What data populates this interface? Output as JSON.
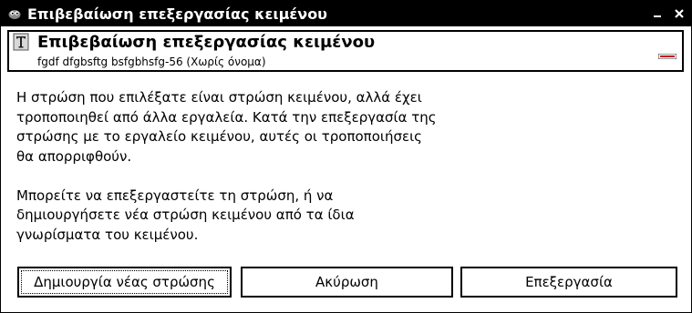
{
  "window": {
    "title": "Επιβεβαίωση επεξεργασίας κειμένου",
    "controls": [
      "minimize-icon",
      "close-icon"
    ]
  },
  "header": {
    "title": "Επιβεβαίωση επεξεργασίας κειμένου",
    "subtitle": "fgdf dfgbsftg bsfgbhsfg-56 (Χωρίς όνομα)",
    "icon": "text-tool-icon",
    "thumbnail": "image-thumbnail"
  },
  "message": {
    "paragraph1": "Η στρώση που επιλέξατε είναι στρώση κειμένου, αλλά έχει\nτροποποιηθεί από άλλα εργαλεία. Κατά την επεξεργασία της\nστρώσης με το εργαλείο κειμένου, αυτές οι τροποποιήσεις\nθα απορριφθούν.",
    "paragraph2": "Μπορείτε να επεξεργαστείτε τη στρώση, ή να\nδημιουργήσετε νέα στρώση κειμένου από τα ίδια\nγνωρίσματα του κειμένου."
  },
  "buttons": {
    "new_layer": "Δημιουργία νέας στρώσης",
    "cancel": "Ακύρωση",
    "edit": "Επεξεργασία"
  },
  "colors": {
    "titlebar_bg": "#000000",
    "titlebar_fg": "#ffffff",
    "background": "#ffffff",
    "thumbnail_accent": "#cc0000"
  }
}
